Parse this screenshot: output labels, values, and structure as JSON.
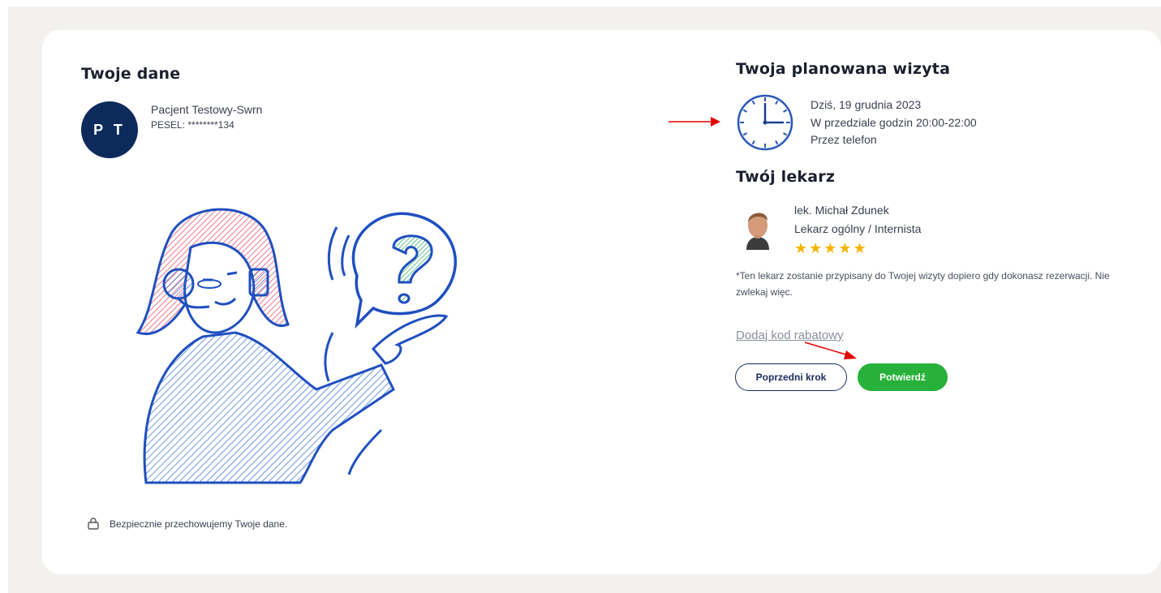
{
  "left": {
    "title": "Twoje dane",
    "avatar_initials": "P T",
    "patient_name": "Pacjent Testowy-Swrn",
    "pesel": "PESEL: ********134",
    "security_note": "Bezpiecznie przechowujemy Twoje dane."
  },
  "visit": {
    "title": "Twoja planowana wizyta",
    "date": "Dziś, 19 grudnia 2023",
    "time_range": "W przedziale godzin 20:00-22:00",
    "channel": "Przez telefon"
  },
  "doctor": {
    "title": "Twój lekarz",
    "name": "lek. Michał Zdunek",
    "specialty": "Lekarz ogólny / Internista",
    "stars": "★★★★★",
    "rating": 5,
    "note": "*Ten lekarz zostanie przypisany do Twojej wizyty dopiero gdy dokonasz rezerwacji. Nie zwlekaj więc."
  },
  "actions": {
    "discount_link": "Dodaj kod rabatowy",
    "prev_label": "Poprzedni krok",
    "confirm_label": "Potwierdź"
  },
  "colors": {
    "avatar_bg": "#0d2a5c",
    "confirm_green": "#27b13a",
    "prev_border": "#1a2b5c",
    "star": "#f5b400",
    "annotation_arrow": "#e60000"
  }
}
